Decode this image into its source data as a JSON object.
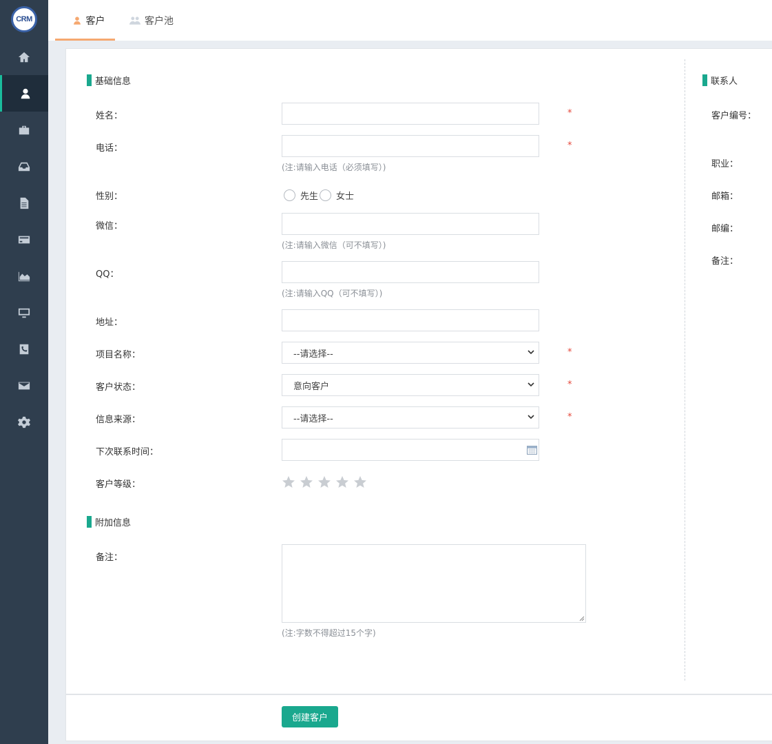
{
  "logo": {
    "text": "CRM"
  },
  "sidebar": {
    "items": [
      {
        "icon": "home-icon"
      },
      {
        "icon": "user-icon",
        "active": true
      },
      {
        "icon": "briefcase-icon"
      },
      {
        "icon": "inbox-icon"
      },
      {
        "icon": "document-icon"
      },
      {
        "icon": "credit-card-icon"
      },
      {
        "icon": "area-chart-icon"
      },
      {
        "icon": "monitor-icon"
      },
      {
        "icon": "phone-icon"
      },
      {
        "icon": "envelope-icon"
      },
      {
        "icon": "gear-icon"
      }
    ]
  },
  "tabs": [
    {
      "label": "客户",
      "active": true
    },
    {
      "label": "客户池",
      "active": false
    }
  ],
  "basic": {
    "title": "基础信息",
    "name_label": "姓名：",
    "phone_label": "电话：",
    "phone_hint": "(注:请输入电话（必须填写）)",
    "gender_label": "性别：",
    "gender_options": [
      "先生",
      "女士"
    ],
    "wechat_label": "微信：",
    "wechat_hint": "(注:请输入微信（可不填写）)",
    "qq_label": "QQ：",
    "qq_hint": "(注:请输入QQ（可不填写）)",
    "address_label": "地址：",
    "project_label": "项目名称：",
    "project_value": "--请选择--",
    "status_label": "客户状态：",
    "status_value": "意向客户",
    "source_label": "信息来源：",
    "source_value": "--请选择--",
    "next_contact_label": "下次联系时间：",
    "level_label": "客户等级：",
    "level_value": 0,
    "level_max": 5,
    "required_mark": "*"
  },
  "extra": {
    "title": "附加信息",
    "remark_label": "备注：",
    "remark_hint": "(注:字数不得超过15个字)"
  },
  "contact": {
    "title": "联系人",
    "labels": [
      "客户编号：",
      "职业：",
      "邮箱：",
      "邮编：",
      "备注："
    ]
  },
  "footer": {
    "create_label": "创建客户"
  },
  "colors": {
    "accent": "#1aa88e",
    "sidebar": "#2f3e4e",
    "tab_underline": "#f5a870",
    "required": "#e5483b"
  }
}
